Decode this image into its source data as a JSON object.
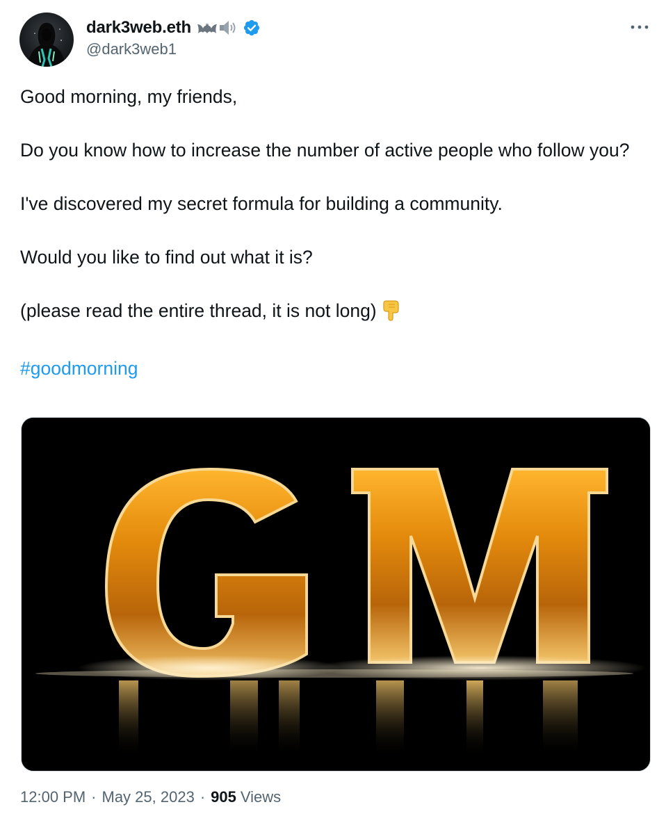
{
  "author": {
    "display_name": "dark3web.eth",
    "name_emojis": [
      "bat-emoji",
      "speaker-emoji"
    ],
    "verified": true,
    "handle": "@dark3web1",
    "avatar_icon": "hooded-figure-avatar"
  },
  "more_icon": "more-horizontal-icon",
  "tweet": {
    "lines": [
      "Good morning, my friends,",
      "Do you know how to increase the number of active people who follow you?",
      "I've discovered my secret formula for building a community.",
      "Would you like to find out what it is?",
      "(please read the entire thread, it is not long)"
    ],
    "pointing_emoji": "backhand-index-pointing-down-emoji",
    "hashtag": "#goodmorning"
  },
  "media": {
    "text": "GM",
    "colors": {
      "background": "#000000",
      "gold": "#e8960f"
    }
  },
  "meta": {
    "time": "12:00 PM",
    "date": "May 25, 2023",
    "separator": "·",
    "views_count": "905",
    "views_label": "Views"
  },
  "colors": {
    "accent": "#1d9bf0",
    "secondary_text": "#536471",
    "primary_text": "#0f1419"
  }
}
